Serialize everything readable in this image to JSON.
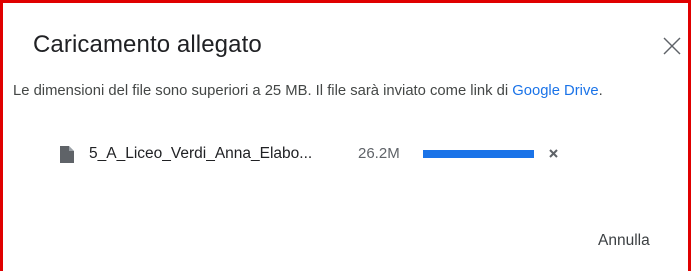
{
  "dialog": {
    "title": "Caricamento allegato",
    "message_prefix": "Le dimensioni del file sono superiori a 25 MB. Il file sarà inviato come link di ",
    "message_link": "Google Drive",
    "message_suffix": ".",
    "close_icon": "close-icon",
    "cancel_label": "Annulla"
  },
  "upload": {
    "file_icon": "file-icon",
    "file_name": "5_A_Liceo_Verdi_Anna_Elabo...",
    "file_size": "26.2M",
    "progress_fraction": 1.0,
    "remove_icon": "remove-icon"
  },
  "colors": {
    "accent": "#1a73e8",
    "frame_highlight": "#e00000"
  }
}
